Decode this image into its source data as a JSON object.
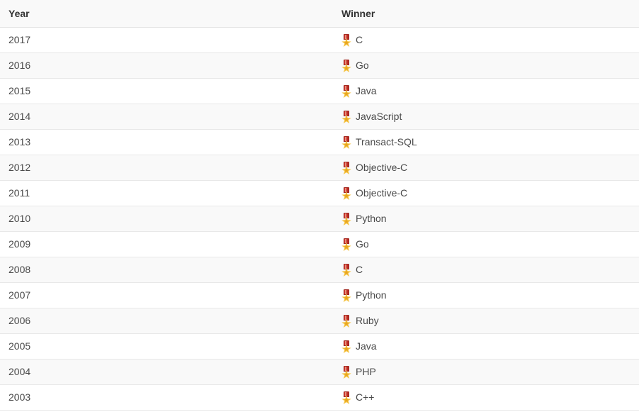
{
  "table": {
    "columns": [
      {
        "key": "year",
        "label": "Year"
      },
      {
        "key": "winner",
        "label": "Winner"
      }
    ],
    "row_icon": "medal-icon",
    "rows": [
      {
        "year": "2017",
        "winner": "C"
      },
      {
        "year": "2016",
        "winner": "Go"
      },
      {
        "year": "2015",
        "winner": "Java"
      },
      {
        "year": "2014",
        "winner": "JavaScript"
      },
      {
        "year": "2013",
        "winner": "Transact-SQL"
      },
      {
        "year": "2012",
        "winner": "Objective-C"
      },
      {
        "year": "2011",
        "winner": "Objective-C"
      },
      {
        "year": "2010",
        "winner": "Python"
      },
      {
        "year": "2009",
        "winner": "Go"
      },
      {
        "year": "2008",
        "winner": "C"
      },
      {
        "year": "2007",
        "winner": "Python"
      },
      {
        "year": "2006",
        "winner": "Ruby"
      },
      {
        "year": "2005",
        "winner": "Java"
      },
      {
        "year": "2004",
        "winner": "PHP"
      },
      {
        "year": "2003",
        "winner": "C++"
      }
    ]
  },
  "colors": {
    "header_bg": "#f9f9f9",
    "stripe_bg": "#f9f9f9",
    "row_bg": "#ffffff",
    "border": "#e8e8e8",
    "header_text": "#333333",
    "body_text": "#4a4a4a",
    "medal_ribbon": "#d0342c",
    "medal_star": "#f5c343"
  }
}
